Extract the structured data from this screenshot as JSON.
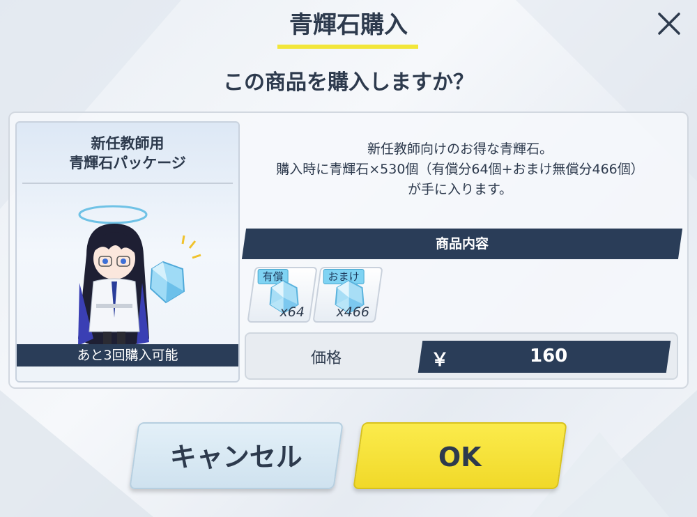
{
  "dialog": {
    "title": "青輝石購入",
    "question": "この商品を購入しますか？",
    "close_icon": "close-icon"
  },
  "product": {
    "name_line1": "新任教師用",
    "name_line2": "青輝石パッケージ",
    "remaining": "あと3回購入可能",
    "desc_line1": "新任教師向けのお得な青輝石。",
    "desc_line2": "購入時に青輝石×530個（有償分64個+おまけ無償分466個）",
    "desc_line3": "が手に入ります。"
  },
  "contents": {
    "header": "商品内容",
    "items": [
      {
        "tag": "有償",
        "qty": "x64",
        "icon": "blue-gem-icon"
      },
      {
        "tag": "おまけ",
        "qty": "x466",
        "icon": "blue-gem-icon"
      }
    ]
  },
  "price": {
    "label": "価格",
    "currency": "￥",
    "value": "160"
  },
  "buttons": {
    "cancel": "キャンセル",
    "ok": "OK"
  },
  "colors": {
    "navy": "#2a3d58",
    "yellow": "#f2e63a",
    "ok_button": "#f5df2e",
    "cancel_button": "#d8e9f4",
    "gem": "#7fc7f0"
  }
}
